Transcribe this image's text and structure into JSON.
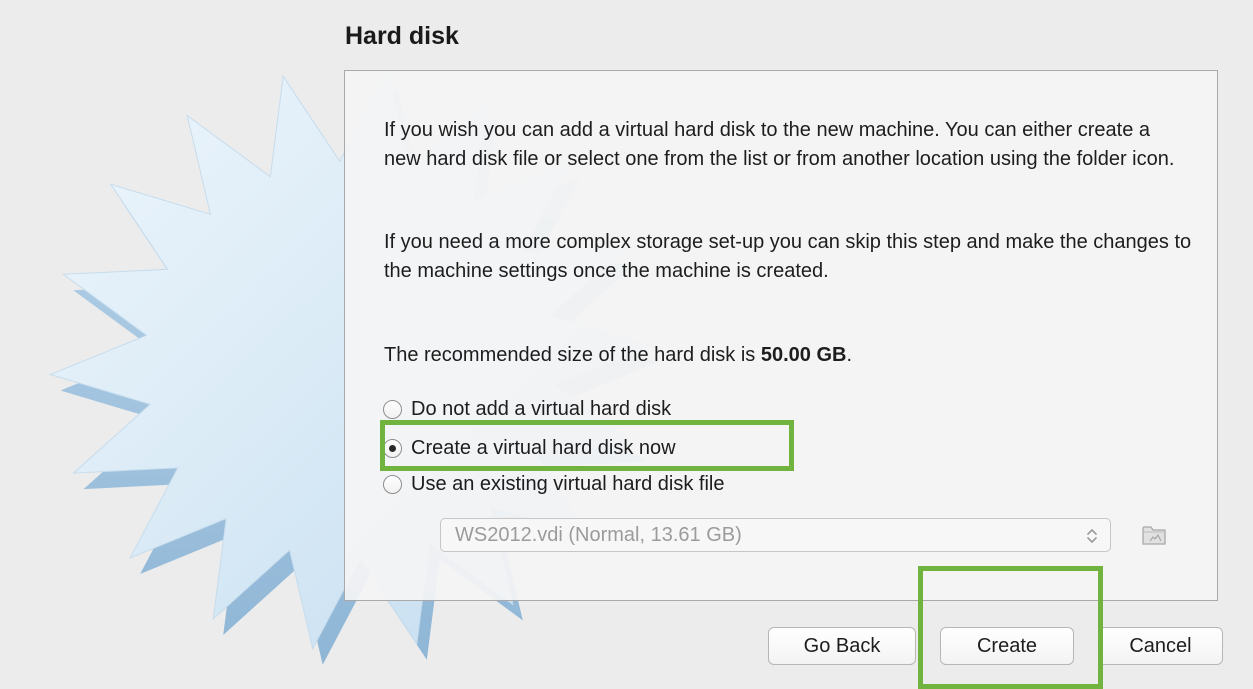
{
  "dialog": {
    "title": "Hard disk",
    "paragraph_1": "If you wish you can add a virtual hard disk to the new machine. You can either create a new hard disk file or select one from the list or from another location using the folder icon.",
    "paragraph_2": "If you need a more complex storage set-up you can skip this step and make the changes to the machine settings once the machine is created.",
    "recommended_prefix": "The recommended size of the hard disk is ",
    "recommended_size": "50.00 GB",
    "recommended_suffix": ".",
    "options": [
      {
        "label": "Do not add a virtual hard disk",
        "selected": false
      },
      {
        "label": "Create a virtual hard disk now",
        "selected": true
      },
      {
        "label": "Use an existing virtual hard disk file",
        "selected": false
      }
    ],
    "existing_disk_select": {
      "value": "WS2012.vdi (Normal, 13.61 GB)",
      "disabled": true
    }
  },
  "buttons": {
    "go_back": "Go Back",
    "create": "Create",
    "cancel": "Cancel"
  },
  "icons": {
    "select_arrows": "updown-chevron-icon",
    "folder": "folder-icon"
  },
  "colors": {
    "highlight": "#71b33f",
    "background": "#ececec",
    "starburst": "#d8e8f4"
  }
}
